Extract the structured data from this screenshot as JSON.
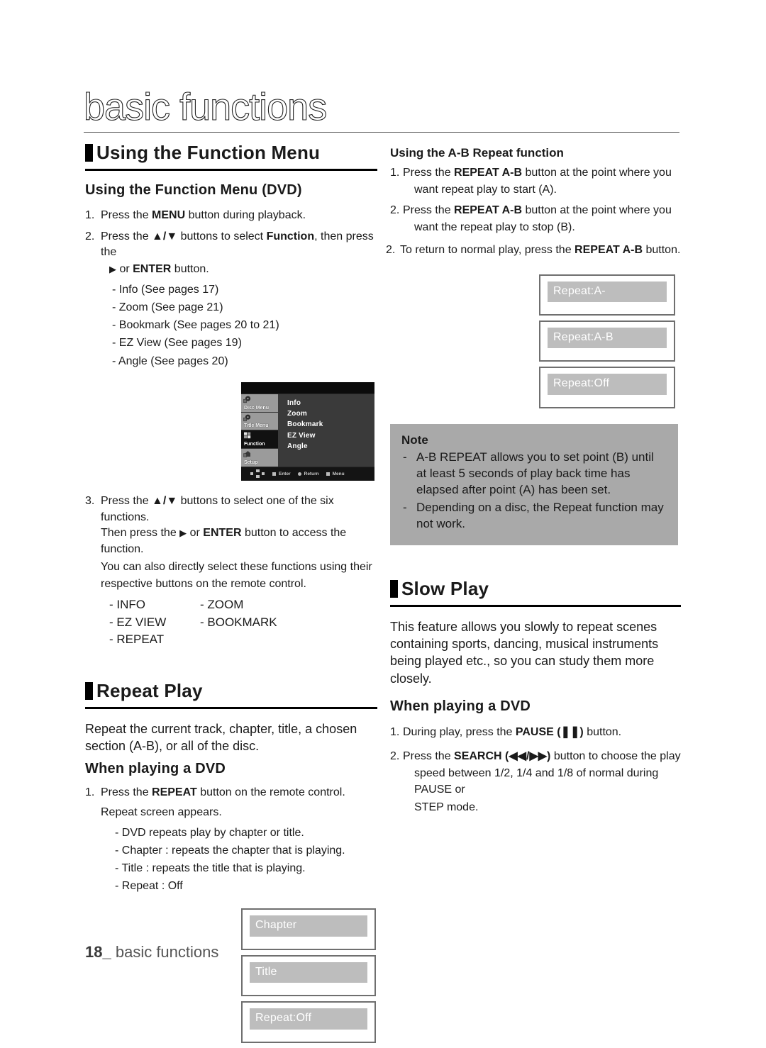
{
  "page": {
    "masthead_title": "basic functions",
    "footer_page_number": "18_",
    "footer_text": "basic functions"
  },
  "left_column": {
    "section_heading": "Using the Function Menu",
    "subsection_heading": "Using the Function Menu (DVD)",
    "steps": [
      {
        "number": "1.",
        "parts": [
          {
            "text": "Press the ",
            "bold": false
          },
          {
            "text": "MENU",
            "bold": true
          },
          {
            "text": " button during playback.",
            "bold": false
          }
        ]
      },
      {
        "number": "2.",
        "parts": [
          {
            "text": "Press the ",
            "bold": false
          },
          {
            "text": "▲/▼",
            "bold": true
          },
          {
            "text": " buttons to select ",
            "bold": false
          },
          {
            "text": "Function",
            "bold": true
          },
          {
            "text": ", then press the",
            "bold": false
          }
        ],
        "continuation_parts": [
          {
            "text": "▶ or ",
            "bold": false
          },
          {
            "text": "ENTER",
            "bold": true
          },
          {
            "text": " button.",
            "bold": false
          }
        ],
        "sub_items": [
          "- Info (See pages 17)",
          "- Zoom (See page 21)",
          "- Bookmark (See pages 20 to 21)",
          "- EZ View (See pages 19)",
          "- Angle (See pages 20)"
        ]
      }
    ],
    "dvd_menu": {
      "sidebar_items": [
        {
          "label": "Disc Menu",
          "icon": "disc-menu-icon",
          "selected": false
        },
        {
          "label": "Title Menu",
          "icon": "title-menu-icon",
          "selected": false
        },
        {
          "label": "Function",
          "icon": "function-icon",
          "selected": true
        },
        {
          "label": "Setup",
          "icon": "setup-icon",
          "selected": false
        }
      ],
      "items": [
        "Info",
        "Zoom",
        "Bookmark",
        "EZ View",
        "Angle"
      ],
      "bottom_bar": [
        {
          "icon": "navpad-icon",
          "label": ""
        },
        {
          "icon": "square-icon",
          "label": "Enter"
        },
        {
          "icon": "circle-icon",
          "label": "Return"
        },
        {
          "icon": "square-icon",
          "label": "Menu"
        }
      ]
    },
    "step3": {
      "number": "3.",
      "parts": [
        {
          "text": "Press the ",
          "bold": false
        },
        {
          "text": "▲/▼",
          "bold": true
        },
        {
          "text": " buttons to select one of the six functions.",
          "bold": false
        }
      ],
      "continuation_lines": [
        [
          {
            "text": "Then press the ",
            "bold": false
          },
          {
            "text": "▶",
            "bold": true
          },
          {
            "text": " or ",
            "bold": false
          },
          {
            "text": "ENTER",
            "bold": true
          },
          {
            "text": " button to access the function.",
            "bold": false
          }
        ],
        [
          {
            "text": "You can also directly select these functions using their",
            "bold": false
          }
        ],
        [
          {
            "text": "respective buttons on the remote control.",
            "bold": false
          }
        ]
      ],
      "function_rows": [
        {
          "left": "- INFO",
          "right": "- ZOOM"
        },
        {
          "left": "- EZ VIEW",
          "right": "- BOOKMARK"
        },
        {
          "left": "- REPEAT",
          "right": ""
        }
      ]
    },
    "repeat_play": {
      "section_heading": "Repeat Play",
      "intro": "Repeat the current track, chapter, title, a chosen section (A-B), or all of the disc.",
      "subsection_heading": "When playing a DVD",
      "step": {
        "number": "1.",
        "parts": [
          {
            "text": "Press the ",
            "bold": false
          },
          {
            "text": "REPEAT",
            "bold": true
          },
          {
            "text": " button on the remote control.",
            "bold": false
          }
        ],
        "continuation": "Repeat screen appears.",
        "sub_items": [
          "- DVD repeats play by chapter or title.",
          "- Chapter : repeats the chapter that is playing.",
          "- Title : repeats the title that is playing.",
          "- Repeat : Off"
        ]
      },
      "osd_boxes": [
        "Chapter",
        "Title",
        "Repeat:Off"
      ]
    }
  },
  "right_column": {
    "ab_repeat": {
      "heading": "Using the A-B Repeat function",
      "steps": [
        {
          "number": "1.",
          "parts": [
            {
              "text": "Press the ",
              "bold": false
            },
            {
              "text": "REPEAT A-B",
              "bold": true
            },
            {
              "text": " button at the point where you",
              "bold": false
            }
          ],
          "continuation": "want repeat play to start (A)."
        },
        {
          "number": "2.",
          "parts": [
            {
              "text": "Press the ",
              "bold": false
            },
            {
              "text": "REPEAT A-B",
              "bold": true
            },
            {
              "text": " button at the point where you",
              "bold": false
            }
          ],
          "continuation": "want the repeat play to stop (B)."
        },
        {
          "number": "2.",
          "parts": [
            {
              "text": "To return to normal play, press the ",
              "bold": false
            },
            {
              "text": "REPEAT A-B",
              "bold": true
            },
            {
              "text": " button.",
              "bold": false
            }
          ],
          "continuation": ""
        }
      ],
      "osd_boxes": [
        "Repeat:A-",
        "Repeat:A-B",
        "Repeat:Off"
      ]
    },
    "note": {
      "title": "Note",
      "items": [
        "A-B REPEAT allows you to set point (B) until at least 5 seconds of play back time has elapsed after point (A) has  been set.",
        "Depending on a disc, the Repeat function may not work."
      ]
    },
    "slow_play": {
      "section_heading": "Slow Play",
      "intro": "This feature allows you slowly to repeat scenes containing sports, dancing, musical instruments being played etc., so you can study them more closely.",
      "subsection_heading": "When playing a DVD",
      "steps": [
        {
          "number": "1.",
          "parts": [
            {
              "text": "During play, press the ",
              "bold": false
            },
            {
              "text": "PAUSE (❚❚)",
              "bold": true
            },
            {
              "text": " button.",
              "bold": false
            }
          ],
          "continuation_lines": []
        },
        {
          "number": "2.",
          "parts": [
            {
              "text": "Press the ",
              "bold": false
            },
            {
              "text": "SEARCH (◀◀/▶▶)",
              "bold": true
            },
            {
              "text": " button to choose the play",
              "bold": false
            }
          ],
          "continuation_lines": [
            "speed between 1/2, 1/4 and 1/8 of normal during PAUSE or",
            "STEP mode."
          ]
        }
      ]
    }
  },
  "colors": {
    "note_background": "#a9a9a9",
    "osd_bar": "#bdbdbd",
    "osd_border": "#6f6f6f",
    "menu_background": "#3a3a3a",
    "menu_selected": "#111111",
    "text": "#1a1a1a"
  }
}
